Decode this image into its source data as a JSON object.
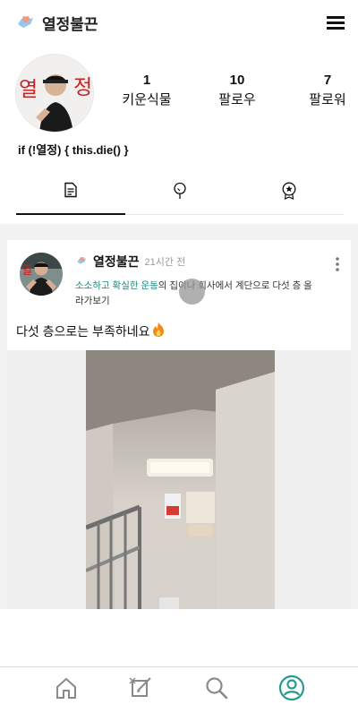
{
  "header": {
    "title": "열정불끈",
    "menu_icon": "hamburger-menu-icon",
    "logo_icon": "heart-hand-icon"
  },
  "profile": {
    "avatar_icon": "profile-photo-avatar",
    "stats": [
      {
        "value": "1",
        "label": "키운식물"
      },
      {
        "value": "10",
        "label": "팔로우"
      },
      {
        "value": "7",
        "label": "팔로워"
      }
    ],
    "bio": "if (!열정) { this.die() }"
  },
  "tabs": [
    {
      "name": "posts",
      "icon": "document-icon",
      "active": true
    },
    {
      "name": "plants",
      "icon": "tree-icon",
      "active": false
    },
    {
      "name": "badges",
      "icon": "badge-star-icon",
      "active": false
    }
  ],
  "post": {
    "author": "열정불끈",
    "time": "21시간 전",
    "challenge_tag": "소소하고 확실한 운동",
    "challenge_suffix": "의 집이나 회사에서 계단으로 다섯 층 올라가보기",
    "text": "다섯 층으로는 부족하네요",
    "text_emoji": "fire-icon",
    "more_icon": "more-vertical-icon"
  },
  "colors": {
    "accent": "#1f8a7f",
    "feed_background": "#f2f2f2"
  },
  "bottom_nav": [
    {
      "name": "home",
      "icon": "home-icon",
      "active": false
    },
    {
      "name": "write",
      "icon": "write-icon",
      "active": false
    },
    {
      "name": "search",
      "icon": "search-icon",
      "active": false
    },
    {
      "name": "profile",
      "icon": "user-circle-icon",
      "active": true
    }
  ]
}
